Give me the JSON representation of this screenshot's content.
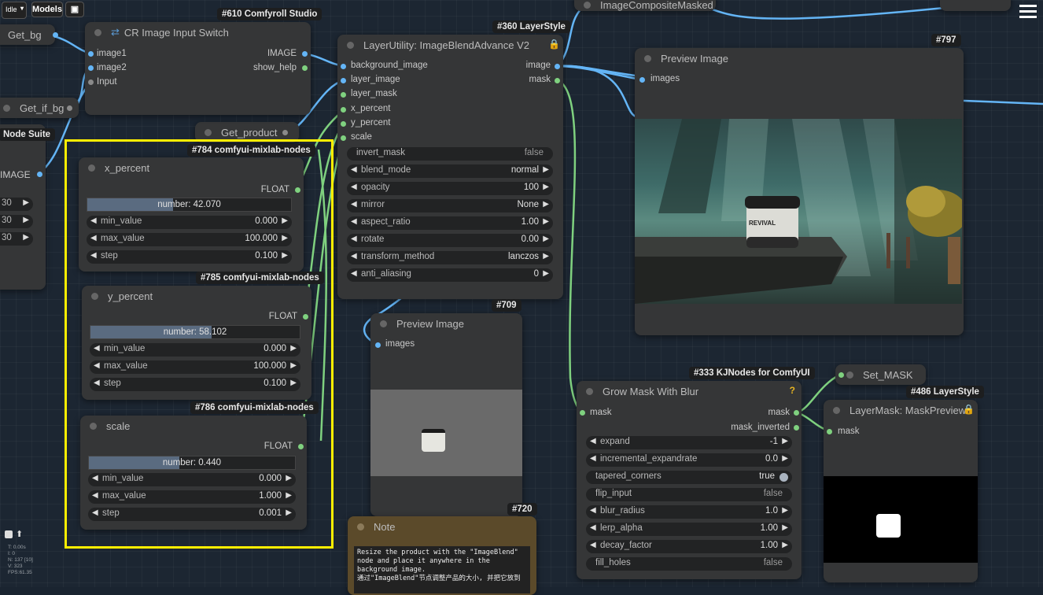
{
  "toolbar": {
    "queue_label": "Idle",
    "models_label": "Models"
  },
  "stats": {
    "lines": [
      "T: 0.00s",
      "I: 0",
      "N: 137 [10]",
      "V: 323",
      "FPS:61.35"
    ]
  },
  "getters": {
    "get_bg": "Get_bg",
    "get_if_bg": "Get_if_bg",
    "get_product": "Get_product",
    "set_mask": "Set_MASK",
    "image_composite": "ImageCompositeMasked",
    "node_suite": "Node Suite",
    "image_out": "IMAGE"
  },
  "left_partial": {
    "values": [
      "30",
      "30",
      "30"
    ]
  },
  "cr_switch": {
    "badge": "#610 Comfyroll Studio",
    "title": "CR Image Input Switch",
    "inputs": [
      "image1",
      "image2",
      "Input"
    ],
    "outputs": [
      "IMAGE",
      "show_help"
    ]
  },
  "blend": {
    "badge": "#360 LayerStyle",
    "title": "LayerUtility: ImageBlendAdvance V2",
    "inputs": [
      "background_image",
      "layer_image",
      "layer_mask",
      "x_percent",
      "y_percent",
      "scale"
    ],
    "outputs": [
      "image",
      "mask"
    ],
    "widgets": [
      {
        "label": "invert_mask",
        "value": "false"
      },
      {
        "label": "blend_mode",
        "value": "normal"
      },
      {
        "label": "opacity",
        "value": "100"
      },
      {
        "label": "mirror",
        "value": "None"
      },
      {
        "label": "aspect_ratio",
        "value": "1.00"
      },
      {
        "label": "rotate",
        "value": "0.00"
      },
      {
        "label": "transform_method",
        "value": "lanczos"
      },
      {
        "label": "anti_aliasing",
        "value": "0"
      }
    ]
  },
  "preview797": {
    "badge": "#797",
    "title": "Preview Image",
    "input": "images",
    "product_label": "REVIVAL"
  },
  "preview709": {
    "badge": "#709",
    "title": "Preview Image",
    "input": "images"
  },
  "xpct": {
    "badge": "#784 comfyui-mixlab-nodes",
    "title": "x_percent",
    "out": "FLOAT",
    "number": "number: 42.070",
    "fill": 0.42,
    "rows": [
      {
        "label": "min_value",
        "value": "0.000"
      },
      {
        "label": "max_value",
        "value": "100.000"
      },
      {
        "label": "step",
        "value": "0.100"
      }
    ]
  },
  "ypct": {
    "badge": "#785 comfyui-mixlab-nodes",
    "title": "y_percent",
    "out": "FLOAT",
    "number": "number: 58.102",
    "fill": 0.58,
    "rows": [
      {
        "label": "min_value",
        "value": "0.000"
      },
      {
        "label": "max_value",
        "value": "100.000"
      },
      {
        "label": "step",
        "value": "0.100"
      }
    ]
  },
  "scale": {
    "badge": "#786 comfyui-mixlab-nodes",
    "title": "scale",
    "out": "FLOAT",
    "number": "number: 0.440",
    "fill": 0.44,
    "rows": [
      {
        "label": "min_value",
        "value": "0.000"
      },
      {
        "label": "max_value",
        "value": "1.000"
      },
      {
        "label": "step",
        "value": "0.001"
      }
    ]
  },
  "note": {
    "badge": "#720",
    "title": "Note",
    "text": "Resize the product with the \"ImageBlend\" node and place it anywhere in the background image.\n通过\"ImageBlend\"节点调整产品的大小, 并把它放到"
  },
  "grow": {
    "badge": "#333 KJNodes for ComfyUI",
    "title": "Grow Mask With Blur",
    "input": "mask",
    "outputs": [
      "mask",
      "mask_inverted"
    ],
    "widgets": [
      {
        "label": "expand",
        "value": "-1"
      },
      {
        "label": "incremental_expandrate",
        "value": "0.0"
      },
      {
        "label": "tapered_corners",
        "value": "true"
      },
      {
        "label": "flip_input",
        "value": "false"
      },
      {
        "label": "blur_radius",
        "value": "1.0"
      },
      {
        "label": "lerp_alpha",
        "value": "1.00"
      },
      {
        "label": "decay_factor",
        "value": "1.00"
      },
      {
        "label": "fill_holes",
        "value": "false"
      }
    ]
  },
  "maskprev": {
    "badge": "#486 LayerStyle",
    "title": "LayerMask: MaskPreview",
    "input": "mask"
  },
  "colors": {
    "highlight": "#ffee00",
    "image_port": "#64b5f6",
    "float_port": "#7fd17f",
    "node_bg": "#353637",
    "canvas_bg": "#1c2632"
  }
}
